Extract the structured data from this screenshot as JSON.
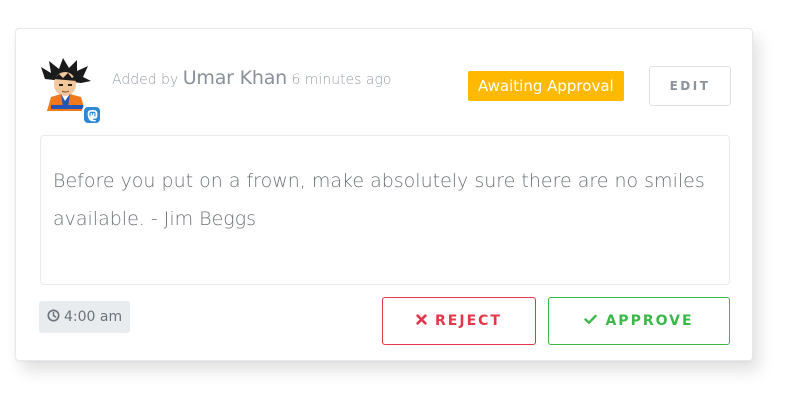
{
  "post": {
    "added_by_prefix": "Added by",
    "author": "Umar Khan",
    "time_ago": "6 minutes ago",
    "avatar_icon": "anime-character-avatar",
    "network_icon": "mastodon-icon",
    "network_color": "#3088d4"
  },
  "status": {
    "label": "Awaiting Approval",
    "color": "#ffba00"
  },
  "actions": {
    "edit_label": "EDIT",
    "reject_label": "REJECT",
    "reject_icon": "times-icon",
    "reject_color": "#e2384a",
    "approve_label": "APPROVE",
    "approve_icon": "check-icon",
    "approve_color": "#3cb84a"
  },
  "message": {
    "text": "Before you put on a frown, make absolutely sure there are no smiles available. - Jim Beggs"
  },
  "schedule": {
    "time": "4:00 am",
    "icon": "clock-icon"
  }
}
